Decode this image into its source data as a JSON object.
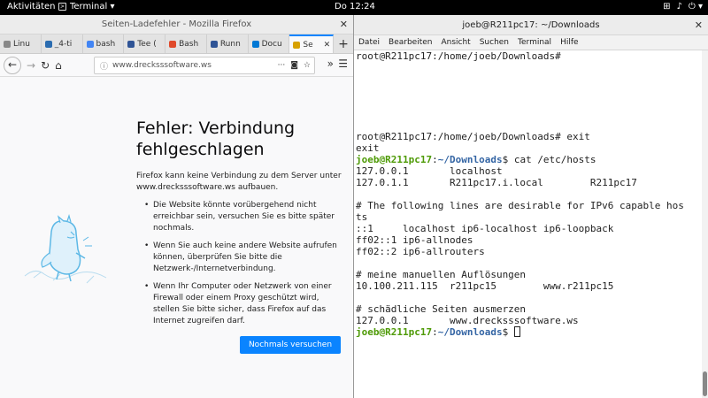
{
  "topbar": {
    "activities": "Aktivitäten",
    "app": "Terminal ▾",
    "clock": "Do 12:24",
    "tray": [
      "⊞",
      "♪",
      "⏻ ▾"
    ]
  },
  "firefox": {
    "title": "Seiten-Ladefehler - Mozilla Firefox",
    "tabs": [
      {
        "label": "Linu",
        "icon_color": "#888888",
        "icon": "linux-tab-icon"
      },
      {
        "label": "_4-ti",
        "icon_color": "#2b6cb0",
        "icon": "cloud-tab-icon"
      },
      {
        "label": "bash",
        "icon_color": "#4285f4",
        "icon": "google-tab-icon"
      },
      {
        "label": "Tee (",
        "icon_color": "#2f5496",
        "icon": "page-tab-icon"
      },
      {
        "label": "Bash",
        "icon_color": "#e04a2b",
        "icon": "stack-tab-icon"
      },
      {
        "label": "Runn",
        "icon_color": "#2f5496",
        "icon": "page-tab-icon"
      },
      {
        "label": "Docu",
        "icon_color": "#0078d4",
        "icon": "vscode-tab-icon"
      },
      {
        "label": "Se",
        "icon_color": "#d7a100",
        "icon": "warning-tab-icon"
      }
    ],
    "url": "www.drecksssoftware.ws",
    "error": {
      "title": "Fehler: Verbindung fehlgeschlagen",
      "description": "Firefox kann keine Verbindung zu dem Server unter www.drecksssoftware.ws aufbauen.",
      "items": [
        "Die Website könnte vorübergehend nicht erreichbar sein, versuchen Sie es bitte später nochmals.",
        "Wenn Sie auch keine andere Website aufrufen können, überprüfen Sie bitte die Netzwerk-/Internetverbindung.",
        "Wenn Ihr Computer oder Netzwerk von einer Firewall oder einem Proxy geschützt wird, stellen Sie bitte sicher, dass Firefox auf das Internet zugreifen darf."
      ],
      "retry": "Nochmals versuchen"
    }
  },
  "terminal": {
    "title": "joeb@R211pc17: ~/Downloads",
    "menu": [
      "Datei",
      "Bearbeiten",
      "Ansicht",
      "Suchen",
      "Terminal",
      "Hilfe"
    ],
    "lines": [
      {
        "text": "root@R211pc17:/home/joeb/Downloads#"
      },
      {
        "text": ""
      },
      {
        "text": ""
      },
      {
        "text": ""
      },
      {
        "text": ""
      },
      {
        "text": ""
      },
      {
        "text": ""
      },
      {
        "text": "root@R211pc17:/home/joeb/Downloads# exit"
      },
      {
        "text": "exit"
      },
      {
        "user": "joeb@R211pc17",
        "path": "~/Downloads",
        "text": "$ cat /etc/hosts"
      },
      {
        "text": "127.0.0.1       localhost"
      },
      {
        "text": "127.0.1.1       R211pc17.i.local        R211pc17"
      },
      {
        "text": ""
      },
      {
        "text": "# The following lines are desirable for IPv6 capable hos"
      },
      {
        "text": "ts"
      },
      {
        "text": "::1     localhost ip6-localhost ip6-loopback"
      },
      {
        "text": "ff02::1 ip6-allnodes"
      },
      {
        "text": "ff02::2 ip6-allrouters"
      },
      {
        "text": ""
      },
      {
        "text": "# meine manuellen Auflösungen"
      },
      {
        "text": "10.100.211.115  r211pc15        www.r211pc15"
      },
      {
        "text": ""
      },
      {
        "text": "# schädliche Seiten ausmerzen"
      },
      {
        "text": "127.0.0.1       www.drecksssoftware.ws"
      },
      {
        "user": "joeb@R211pc17",
        "path": "~/Downloads",
        "text": "$ ",
        "cursor": true
      }
    ]
  }
}
